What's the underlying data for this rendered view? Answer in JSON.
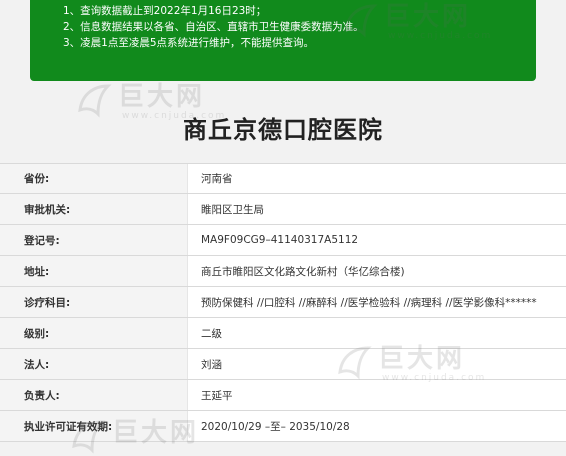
{
  "notice": {
    "lines": [
      "1、查询数据截止到2022年1月16日23时；",
      "2、信息数据结果以各省、自治区、直辖市卫生健康委数据为准。",
      "3、凌晨1点至凌晨5点系统进行维护，不能提供查询。"
    ],
    "background": "#118a1c"
  },
  "title": "商丘京德口腔医院",
  "fields": [
    {
      "label": "省份:",
      "value": "河南省"
    },
    {
      "label": "审批机关:",
      "value": "睢阳区卫生局"
    },
    {
      "label": "登记号:",
      "value": "MA9F09CG9–41140317A5112"
    },
    {
      "label": "地址:",
      "value": "商丘市睢阳区文化路文化新村（华亿综合楼)"
    },
    {
      "label": "诊疗科目:",
      "value": "预防保健科 //口腔科 //麻醉科 //医学检验科 //病理科 //医学影像科******"
    },
    {
      "label": "级别:",
      "value": "二级"
    },
    {
      "label": "法人:",
      "value": "刘涵"
    },
    {
      "label": "负责人:",
      "value": "王延平"
    },
    {
      "label": "执业许可证有效期:",
      "value": "2020/10/29 –至– 2035/10/28"
    }
  ],
  "watermark": {
    "brand": "巨大网",
    "site": "www.cnjuda.com"
  }
}
